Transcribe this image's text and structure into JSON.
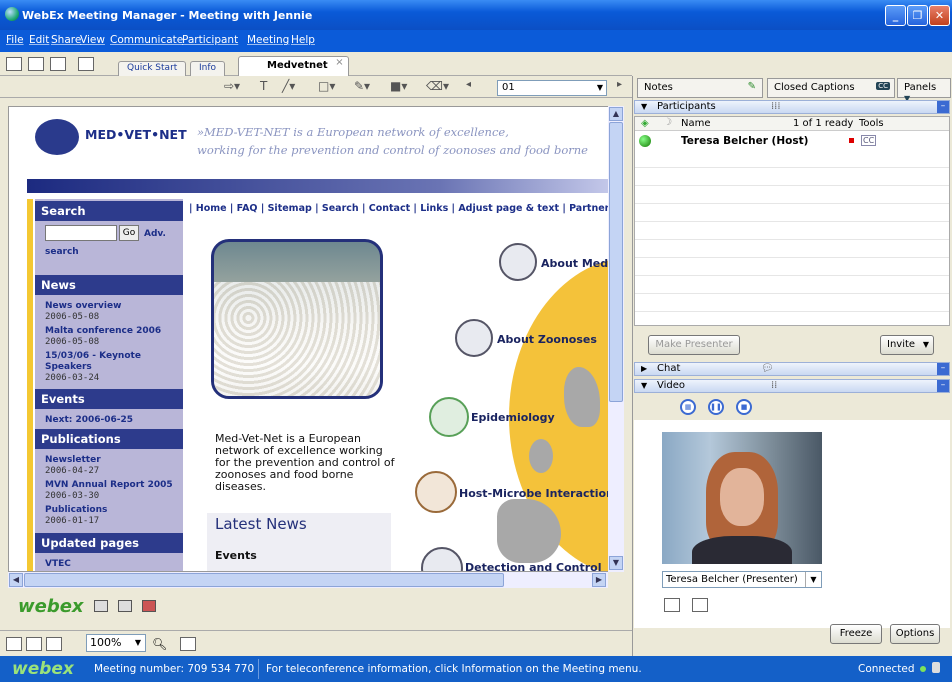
{
  "window": {
    "title": "WebEx Meeting Manager - Meeting with Jennie"
  },
  "menu": [
    "File",
    "Edit",
    "Share",
    "View",
    "Communicate",
    "Participant",
    "Meeting",
    "Help"
  ],
  "tabs": [
    {
      "label": "Quick Start"
    },
    {
      "label": "Info"
    },
    {
      "label": "Medvetnet",
      "active": true,
      "close": "×"
    }
  ],
  "slide_box": {
    "value": "01"
  },
  "webpage": {
    "logo_text": "MED•VET•NET",
    "tagline1": "»MED-VET-NET is a European network of excellence,",
    "tagline2": "working for the prevention and control of zoonoses and food borne",
    "nav": "| Home | FAQ | Sitemap | Search | Contact | Links | Adjust page & text | Partner",
    "search_head": "Search",
    "go": "Go",
    "adv": "Adv.",
    "search_link": "search",
    "news_head": "News",
    "news": [
      {
        "t": "News overview",
        "d": "2006-05-08"
      },
      {
        "t": "Malta conference 2006",
        "d": "2006-05-08"
      },
      {
        "t": "15/03/06 - Keynote Speakers",
        "d": "2006-03-24"
      }
    ],
    "events_head": "Events",
    "events_next": "Next: 2006-06-25",
    "pubs_head": "Publications",
    "pubs": [
      {
        "t": "Newsletter",
        "d": "2006-04-27"
      },
      {
        "t": "MVN Annual Report 2005",
        "d": "2006-03-30"
      },
      {
        "t": "Publications",
        "d": "2006-01-17"
      }
    ],
    "updated_head": "Updated pages",
    "updated_first": "VTEC",
    "intro": "Med-Vet-Net is a European network of excellence working for the prevention and control of zoonoses and food borne diseases.",
    "latest_news": "Latest News",
    "events_sub": "Events",
    "topics": [
      "About Med-",
      "About Zoonoses",
      "Epidemiology",
      "Host-Microbe Interaction",
      "Detection and Control"
    ]
  },
  "left_footer": {
    "logo": "webex",
    "zoom": "100%"
  },
  "right": {
    "tabs": {
      "notes": "Notes",
      "captions": "Closed Captions",
      "cc": "CC",
      "panels": "Panels"
    },
    "participants": {
      "head": "Participants",
      "col_name": "Name",
      "ready": "1 of 1 ready",
      "col_tools": "Tools",
      "rows": [
        {
          "name": "Teresa Belcher (Host)",
          "cc": "CC"
        }
      ],
      "make_presenter": "Make Presenter",
      "invite": "Invite"
    },
    "chat_head": "Chat",
    "video_head": "Video",
    "presenter_select": "Teresa Belcher (Presenter)",
    "freeze": "Freeze",
    "options": "Options"
  },
  "status": {
    "logo": "webex",
    "meeting": "Meeting number: 709 534 770",
    "info": "For teleconference information, click Information on the Meeting menu.",
    "connected": "Connected"
  }
}
